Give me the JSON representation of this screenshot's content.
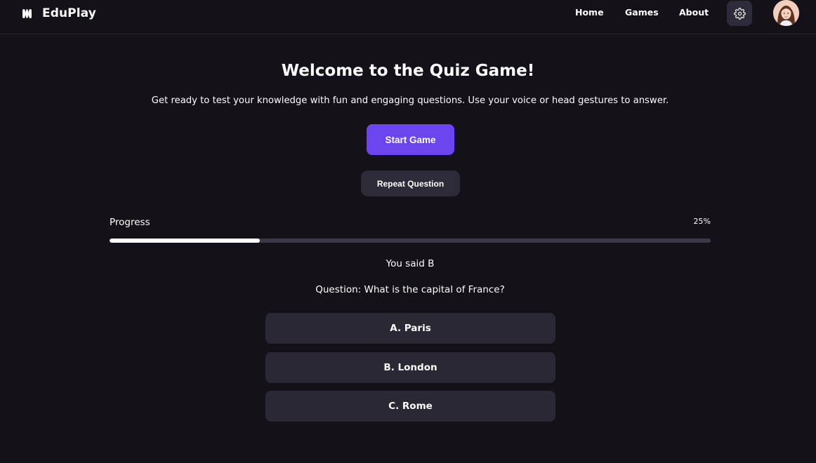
{
  "header": {
    "brand": "EduPlay",
    "nav": [
      "Home",
      "Games",
      "About"
    ]
  },
  "main": {
    "title": "Welcome to the Quiz Game!",
    "subtitle": "Get ready to test your knowledge with fun and engaging questions. Use your voice or head gestures to answer.",
    "start_button": "Start Game",
    "repeat_button": "Repeat Question",
    "progress": {
      "label": "Progress",
      "percent_text": "25%",
      "value": 0.25
    },
    "you_said": "You said B",
    "question": "Question: What is the capital of France?",
    "options": [
      "A. Paris",
      "B. London",
      "C. Rome"
    ]
  },
  "colors": {
    "background": "#141218",
    "accent": "#6a45f0",
    "button_dark": "#2d2b37",
    "option_bg": "#2a2833",
    "progress_track": "#3b3948"
  }
}
